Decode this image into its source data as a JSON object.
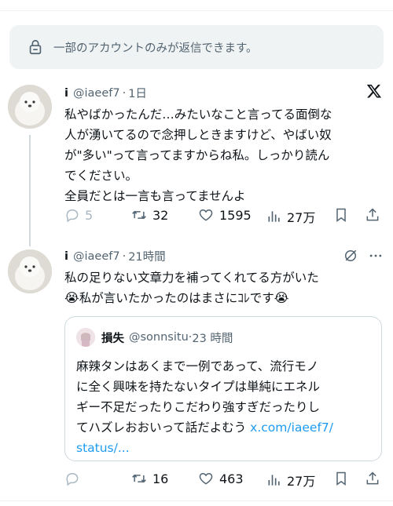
{
  "notice": {
    "text": "一部のアカウントのみが返信できます。"
  },
  "tweet1": {
    "name": "i",
    "handle": "@iaeef7",
    "dot": "·",
    "time": "1日",
    "body": "私やばかったんだ…みたいなこと言ってる面倒な\n人が湧いてるので念押しときますけど、やばい奴\nが\"多い\"って言ってますからね私。しっかり読ん\nでください。\n全員だとは一言も言ってませんよ",
    "replies": "5",
    "retweets": "32",
    "likes": "1595",
    "views": "27万"
  },
  "tweet2": {
    "name": "i",
    "handle": "@iaeef7",
    "dot": "·",
    "time": "21時間",
    "line1": "私の足りない文章力を補ってくれてる方がいた",
    "emoji": "😭",
    "line2": "私が言いたかったのはまさにｺﾚです",
    "retweets": "16",
    "likes": "463",
    "views": "27万"
  },
  "quote": {
    "name": "損失",
    "handle": "@sonnsitu",
    "dot": "·",
    "time": "23 時間",
    "body": "麻辣タンはあくまで一例であって、流行モノ\nに全く興味を持たないタイプは単純にエネル\nギー不足だったりこだわり強すぎだったりし\nてハズレおおいって話だよむう ",
    "link": "x.com/iaeef7/\nstatus/..."
  },
  "colors": {
    "muted": "#536471",
    "link": "#1d9bf0",
    "border": "#cfd9de"
  },
  "icons": [
    "lock-icon",
    "x-logo-icon",
    "reply-icon",
    "retweet-icon",
    "like-icon",
    "views-icon",
    "bookmark-icon",
    "share-icon",
    "grok-icon",
    "more-icon"
  ]
}
